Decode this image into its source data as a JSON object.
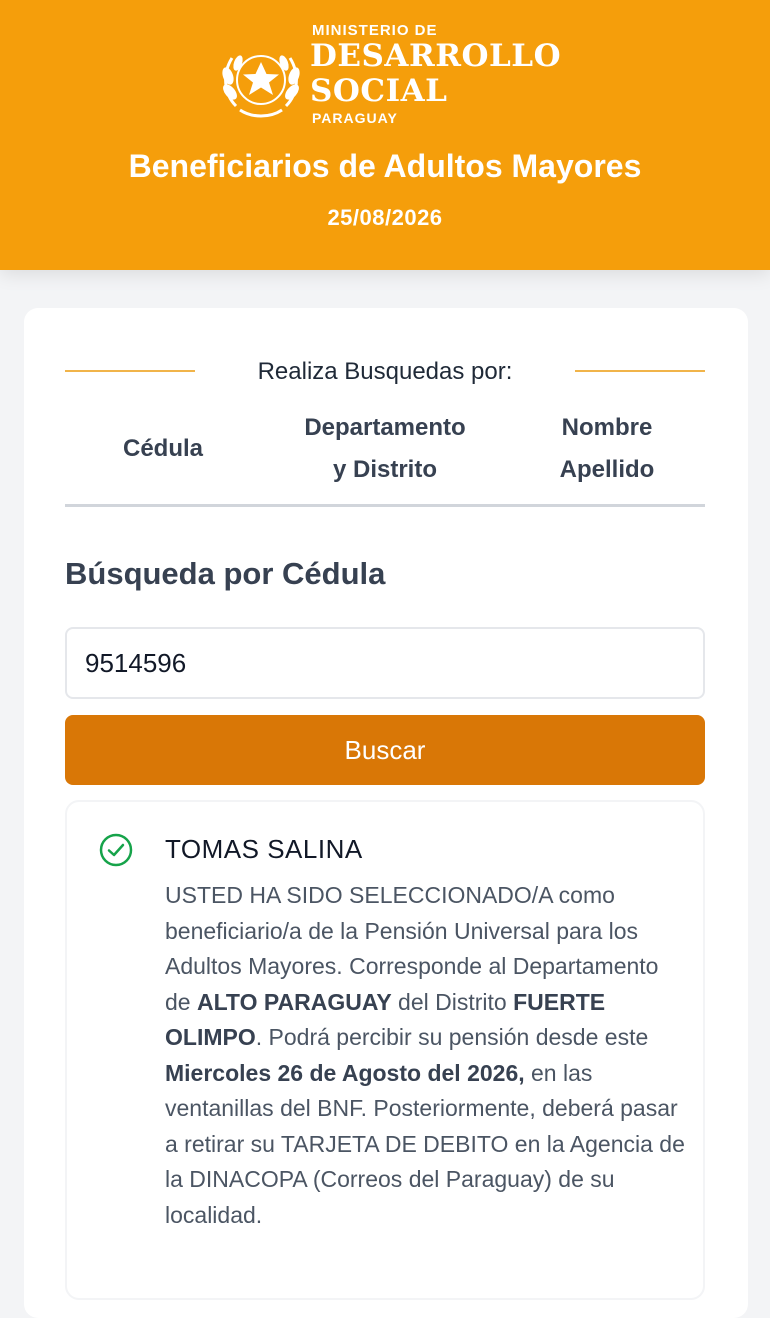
{
  "header": {
    "logo": {
      "line1": "MINISTERIO DE",
      "line2": "DESARROLLO",
      "line3": "SOCIAL",
      "line4": "PARAGUAY",
      "icon": "star-laurel-seal-icon"
    },
    "title": "Beneficiarios de Adultos Mayores",
    "date": "25/08/2026",
    "background_color": "#f59e0b"
  },
  "search": {
    "caption": "Realiza Busquedas por:",
    "tabs": [
      {
        "line1": "Cédula",
        "line2": ""
      },
      {
        "line1": "Departamento",
        "line2": "y Distrito"
      },
      {
        "line1": "Nombre",
        "line2": "Apellido"
      }
    ],
    "section_title": "Búsqueda por Cédula",
    "cedula_value": "9514596",
    "button_label": "Buscar",
    "button_color": "#d97706"
  },
  "result": {
    "status_icon": "check-circle-icon",
    "status_color": "#16a34a",
    "name": "TOMAS SALINA",
    "message": {
      "p1": "USTED HA SIDO SELECCIONADO/A como beneficiario/a de la Pensión Universal para los Adultos Mayores. Corresponde al Departamento de ",
      "departamento": "ALTO PARAGUAY",
      "p2": " del Distrito ",
      "distrito": "FUERTE OLIMPO",
      "p3": ". Podrá percibir su pensión desde este ",
      "fecha": "Miercoles 26 de Agosto del 2026,",
      "p4": " en las ventanillas del BNF. Posteriormente, deberá pasar a retirar su TARJETA DE DEBITO en la Agencia de la DINACOPA (Correos del Paraguay) de su localidad."
    }
  }
}
